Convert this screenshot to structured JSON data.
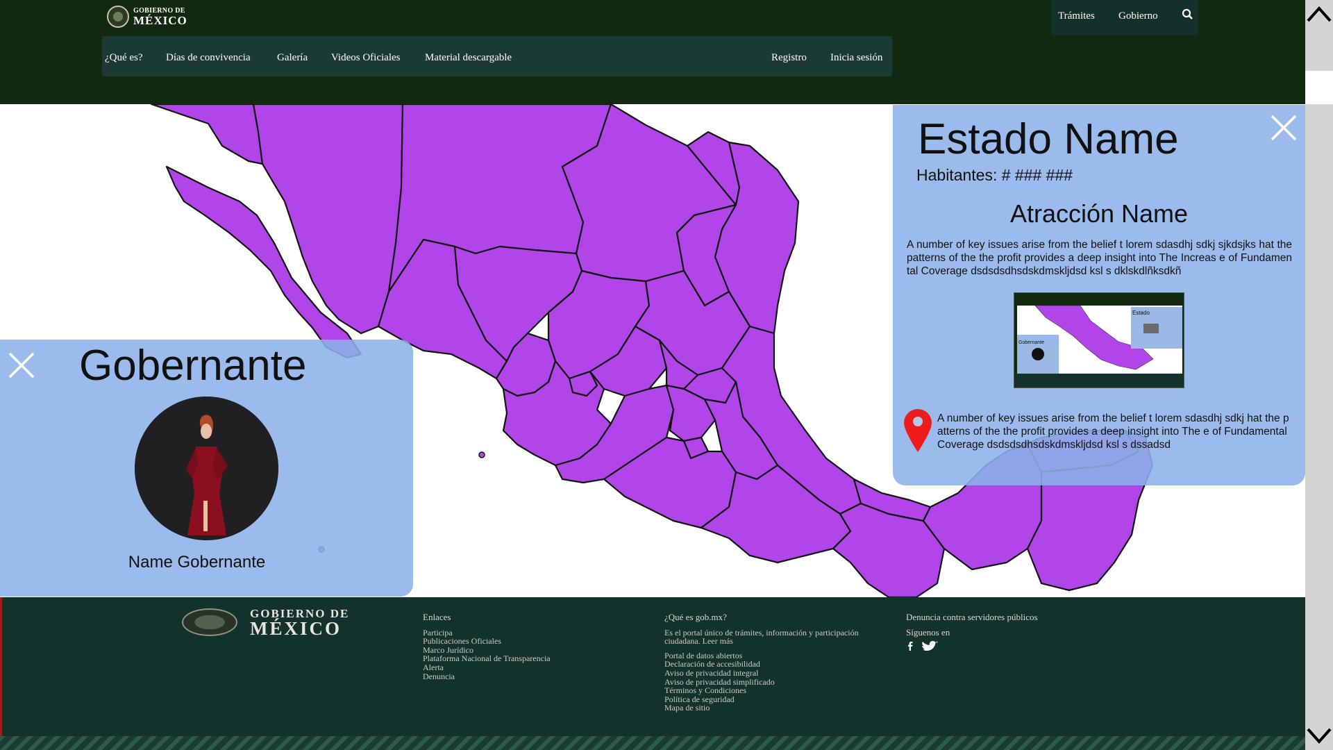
{
  "header": {
    "logo_top": "GOBIERNO DE",
    "logo_bottom": "MÉXICO",
    "top_links": [
      "Trámites",
      "Gobierno"
    ],
    "nav_left": [
      "¿Qué es?",
      "Días de convivencia",
      "Galería",
      "Videos Oficiales",
      "Material descargable"
    ],
    "nav_right": [
      "Registro",
      "Inicia sesión"
    ]
  },
  "map": {
    "fill_color": "#b145e9",
    "border_color": "#111111"
  },
  "state_panel": {
    "title": "Estado Name",
    "population": "Habitantes: # ### ###",
    "attraction_title": "Atracción Name",
    "attraction_desc": "A number of key issues arise from the belief t lorem sdasdhj sdkj sjkdsjks hat the patterns of the the profit provides a deep insight into The Increas e of Fundamental Coverage dsdsdsdhsdskdmskljdsd ksl s dklskdlñksdkñ",
    "thumb_estado": "Estado",
    "thumb_gobernante": "Gobernante",
    "location_desc": "A number of key issues arise from the belief t lorem sdasdhj sdkj hat the patterns of the the profit provides a deep insight into The e of Fundamental Coverage dsdsdsdhsdskdmskljdsd ksl s dssadsd"
  },
  "governor_panel": {
    "title": "Gobernante",
    "name": "Name Gobernante"
  },
  "footer": {
    "logo_top": "GOBIERNO DE",
    "logo_bottom": "MÉXICO",
    "links_heading": "Enlaces",
    "links": [
      "Participa",
      "Publicaciones Oficiales",
      "Marco Jurídico",
      "Plataforma Nacional de Transparencia",
      "Alerta",
      "Denuncia"
    ],
    "about_heading": "¿Qué es gob.mx?",
    "about_text": "Es el portal único de trámites, información y participación ciudadana. Leer más",
    "about_links": [
      "Portal de datos abiertos",
      "Declaración de accesibilidad",
      "Aviso de privacidad integral",
      "Aviso de privacidad simplificado",
      "Términos y Condiciones",
      "Política de seguridad",
      "Mapa de sitio"
    ],
    "report": "Denuncia contra servidores públicos",
    "follow": "Síguenos en"
  }
}
